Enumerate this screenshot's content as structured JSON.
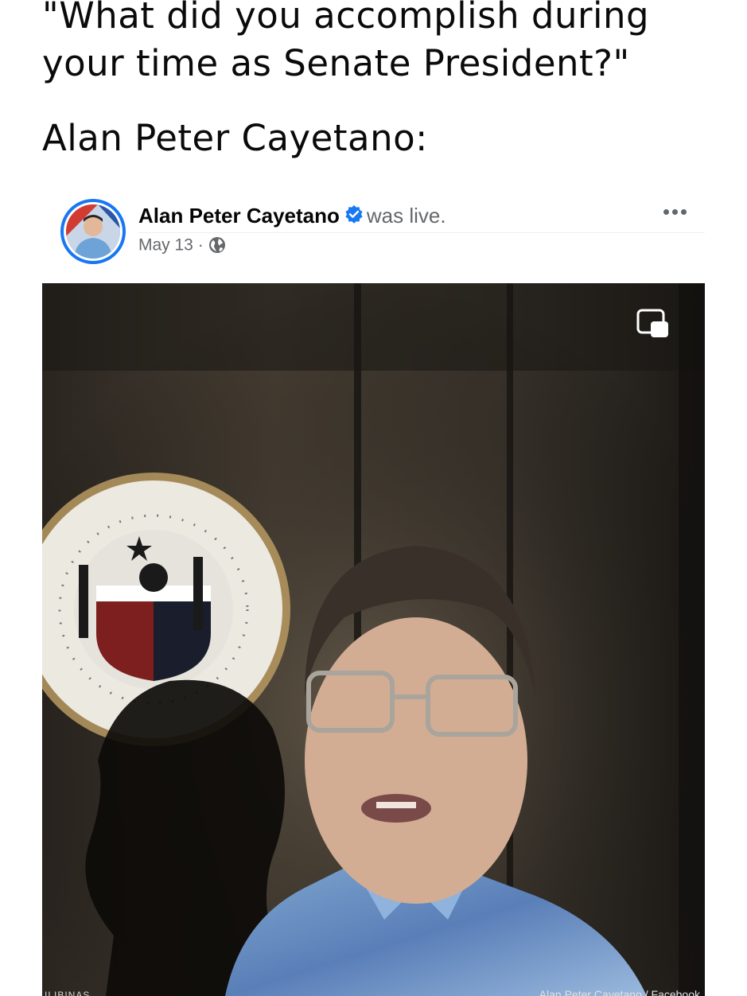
{
  "caption": {
    "question": "\"What did you accomplish during your time as Senate President?\"",
    "speaker": "Alan Peter Cayetano:"
  },
  "post": {
    "poster_name": "Alan Peter Cayetano",
    "action": "was live.",
    "date": "May 13",
    "separator": "·",
    "verified_icon": "verified-badge-icon",
    "privacy_icon": "globe-icon",
    "more_icon": "more-options-icon"
  },
  "video": {
    "pip_icon": "picture-in-picture-icon",
    "seal_text_top": "ENATE OF THE PHILIPPINES",
    "seal_text_bottom": "SEAL",
    "watermark_left": "ILIBINAS",
    "watermark_right": "Alan Peter Cayetano / Facebook"
  },
  "colors": {
    "accent": "#1877f2",
    "meta_gray": "#65676b"
  }
}
